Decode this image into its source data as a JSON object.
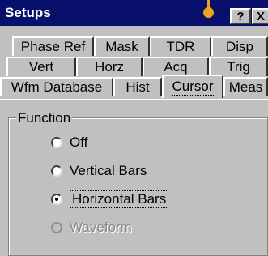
{
  "window": {
    "title": "Setups"
  },
  "titlebar_buttons": {
    "help": "?",
    "close": "X"
  },
  "tabs": {
    "row1": [
      "Phase Ref",
      "Mask",
      "TDR",
      "Disp"
    ],
    "row2": [
      "Vert",
      "Horz",
      "Acq",
      "Trig"
    ],
    "row3": [
      "Wfm Database",
      "Hist",
      "Cursor",
      "Meas"
    ],
    "active": "Cursor"
  },
  "function_group": {
    "label": "Function",
    "options": [
      {
        "label": "Off",
        "selected": false,
        "enabled": true
      },
      {
        "label": "Vertical Bars",
        "selected": false,
        "enabled": true
      },
      {
        "label": "Horizontal Bars",
        "selected": true,
        "enabled": true
      },
      {
        "label": "Waveform",
        "selected": false,
        "enabled": false
      }
    ]
  },
  "colors": {
    "titlebar": "#08106b",
    "dialog_face": "#c0c0c0",
    "callout": "#e8a21e"
  }
}
